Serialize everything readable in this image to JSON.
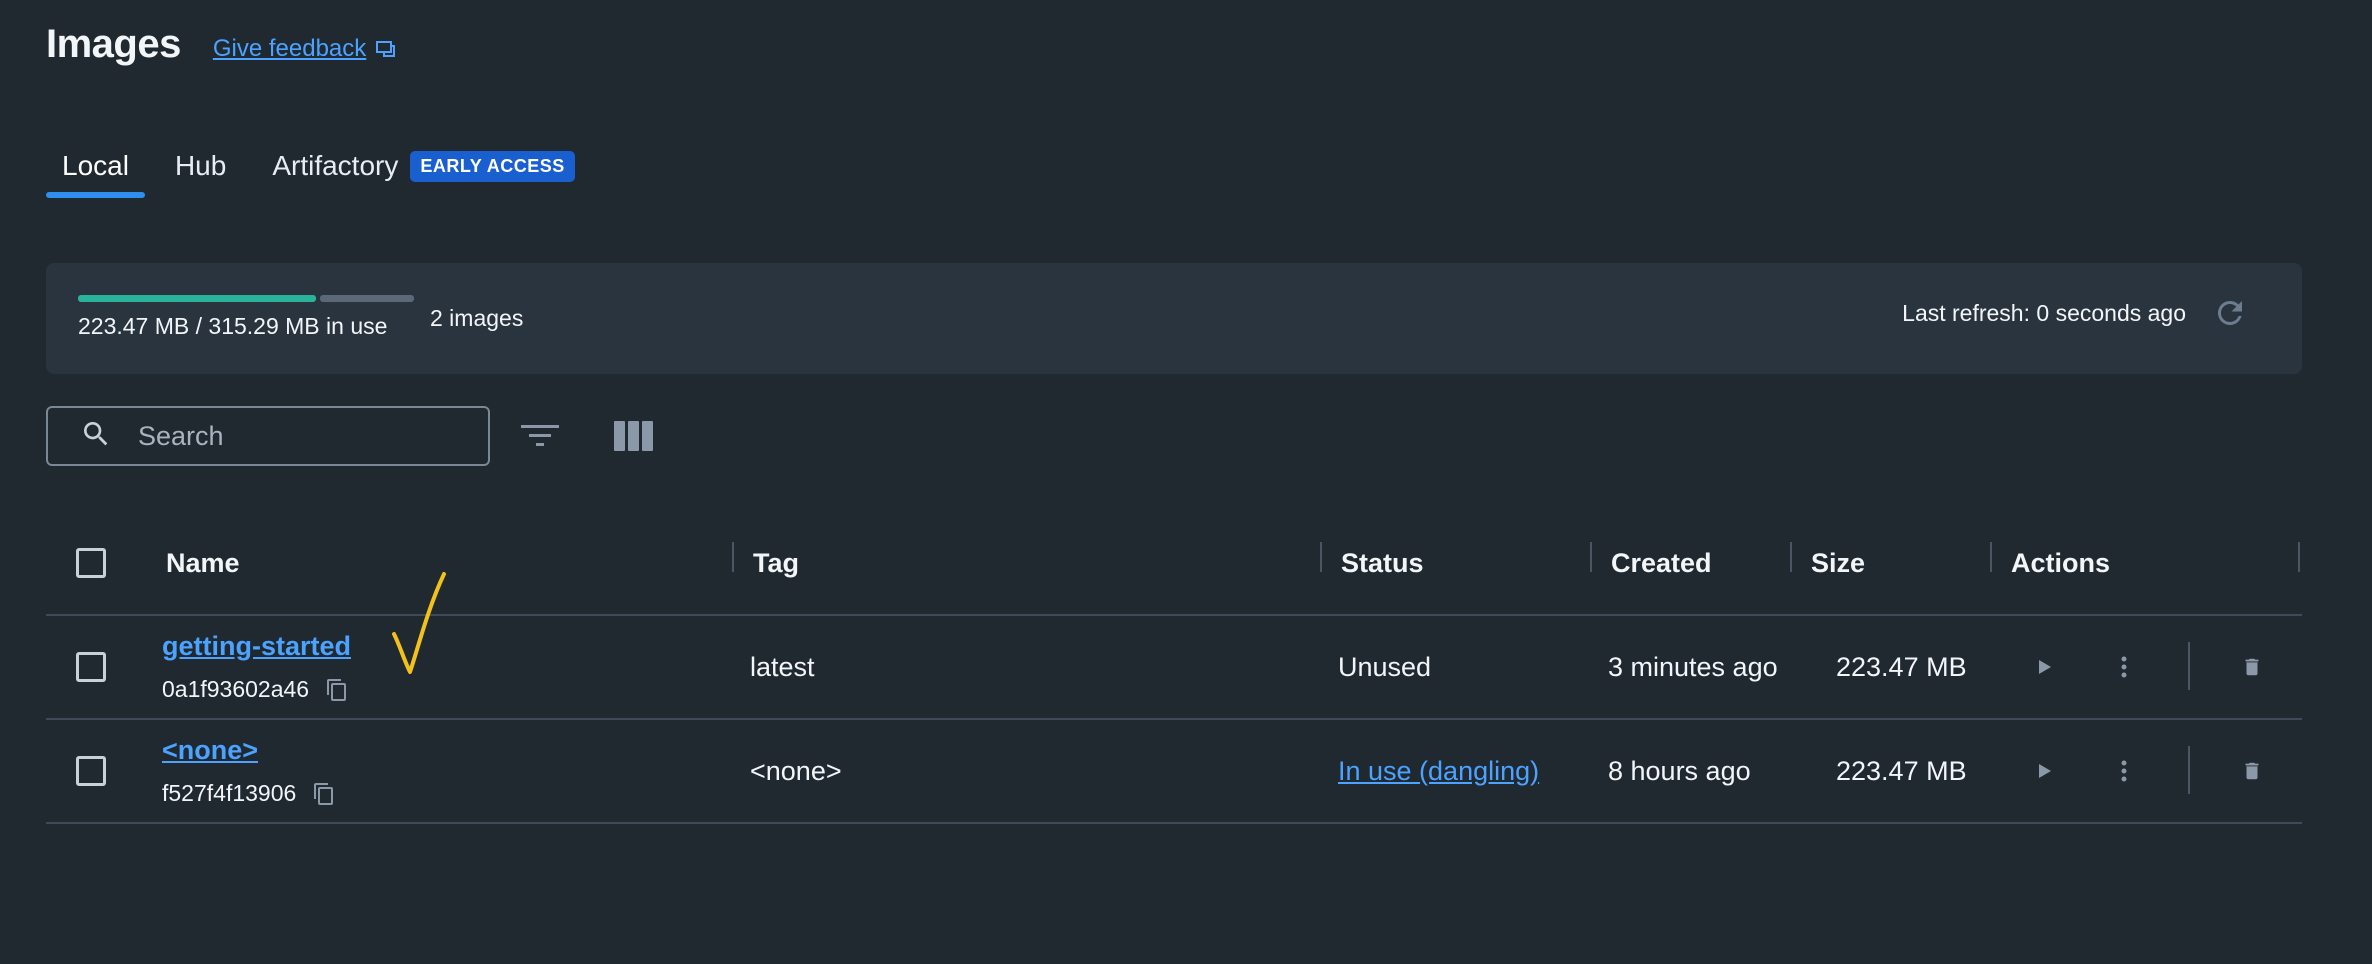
{
  "header": {
    "title": "Images",
    "feedback_label": "Give feedback"
  },
  "tabs": [
    {
      "label": "Local",
      "active": true
    },
    {
      "label": "Hub",
      "active": false
    },
    {
      "label": "Artifactory",
      "active": false,
      "badge": "EARLY ACCESS"
    }
  ],
  "usage": {
    "text": "223.47 MB / 315.29 MB in use",
    "used_fraction": 0.709,
    "image_count": "2 images",
    "last_refresh": "Last refresh: 0 seconds ago"
  },
  "search": {
    "placeholder": "Search",
    "value": ""
  },
  "table": {
    "columns": [
      "Name",
      "Tag",
      "Status",
      "Created",
      "Size",
      "Actions"
    ],
    "rows": [
      {
        "name": "getting-started",
        "id": "0a1f93602a46",
        "tag": "latest",
        "status": "Unused",
        "status_is_link": false,
        "created": "3 minutes ago",
        "size": "223.47 MB"
      },
      {
        "name": "<none>",
        "id": "f527f4f13906",
        "tag": "<none>",
        "status": "In use (dangling)",
        "status_is_link": true,
        "created": "8 hours ago",
        "size": "223.47 MB"
      }
    ]
  },
  "colors": {
    "background": "#202830",
    "panel": "#29343f",
    "accent": "#2f8ff0",
    "link": "#4ba3ff",
    "usage_fill": "#2ab39a",
    "badge": "#1a5fd0",
    "annotation": "#f2c21b"
  },
  "icons": {
    "feedback": "feedback-icon",
    "refresh": "refresh-icon",
    "search": "search-icon",
    "filter": "filter-icon",
    "columns": "columns-icon",
    "copy": "copy-icon",
    "run": "play-icon",
    "more": "more-vertical-icon",
    "delete": "trash-icon"
  }
}
